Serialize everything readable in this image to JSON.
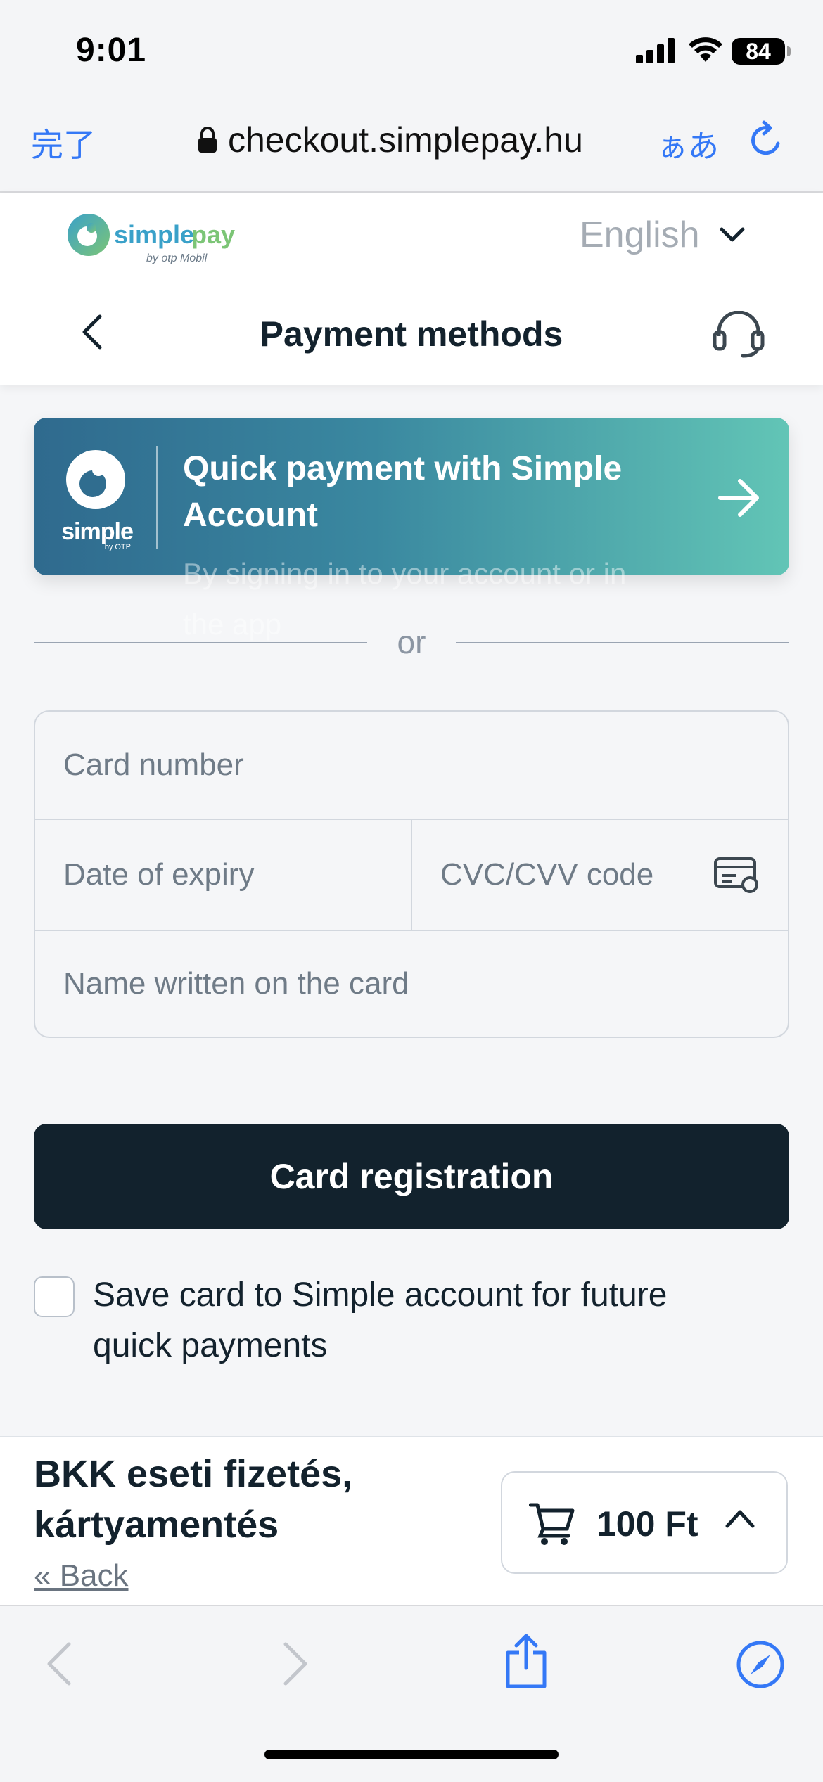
{
  "status_bar": {
    "time": "9:01",
    "battery": "84"
  },
  "browser": {
    "done_label": "完了",
    "url": "checkout.simplepay.hu",
    "text_size_label": "ぁあ"
  },
  "header": {
    "logo_text": "simplepay",
    "logo_byline": "by otp Mobil",
    "language": "English",
    "title": "Payment methods"
  },
  "quick_pay": {
    "logo_text": "simple",
    "logo_byline": "by OTP",
    "title": "Quick payment with Simple Account",
    "subtitle": "By signing in to your account or in the app"
  },
  "divider": {
    "or_label": "or"
  },
  "card_form": {
    "card_number_placeholder": "Card number",
    "expiry_placeholder": "Date of expiry",
    "cvc_placeholder": "CVC/CVV code",
    "name_placeholder": "Name written on the card"
  },
  "register_button": "Card registration",
  "save_card": {
    "label": "Save card to Simple account for future quick payments",
    "checked": false
  },
  "summary": {
    "merchant": "BKK eseti fizetés, kártyamentés",
    "back_link": "« Back",
    "amount": "100 Ft"
  },
  "colors": {
    "accent": "#3478f6",
    "dark_button": "#12222d",
    "banner_start": "#2f6a8e",
    "banner_end": "#62c5b6"
  }
}
